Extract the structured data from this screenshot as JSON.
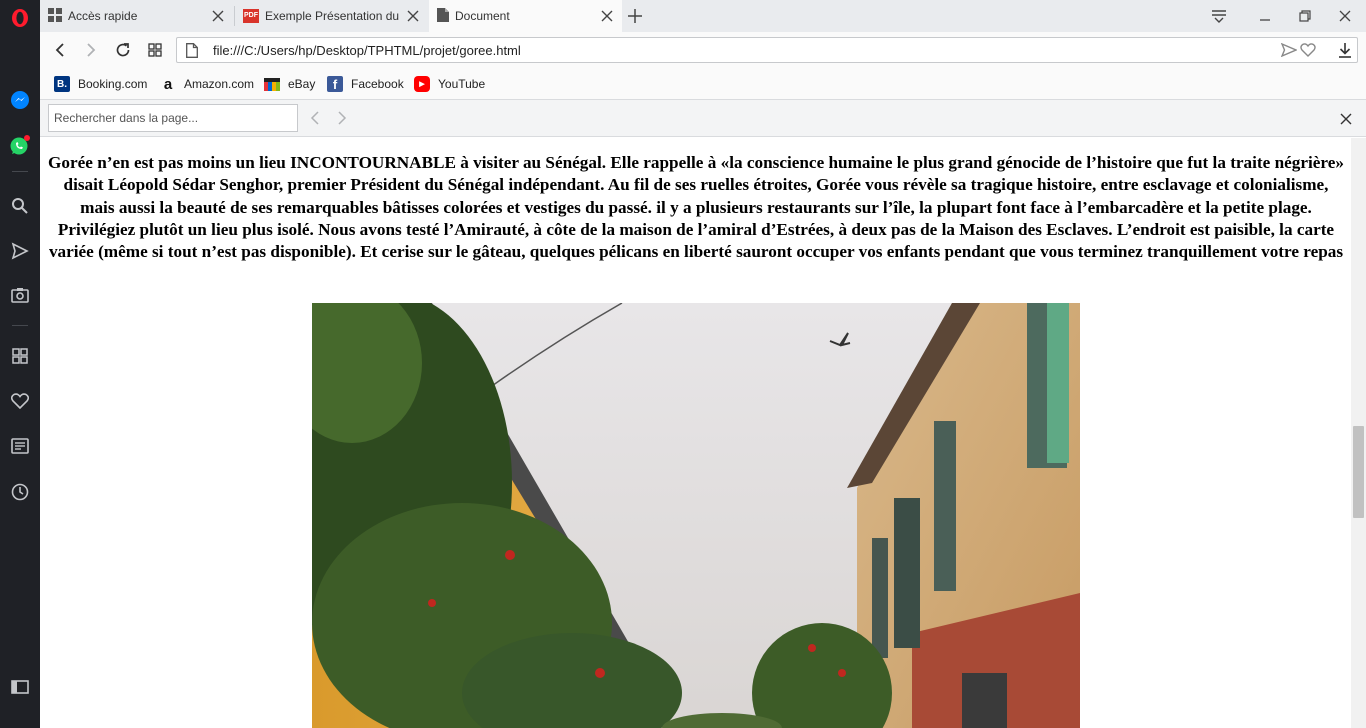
{
  "tabs": [
    {
      "label": "Accès rapide",
      "icon": "grid-icon"
    },
    {
      "label": "Exemple Présentation du p",
      "icon": "pdf-icon",
      "badge": "PDF"
    },
    {
      "label": "Document",
      "icon": "document-icon"
    }
  ],
  "address": {
    "url": "file:///C:/Users/hp/Desktop/TPHTML/projet/goree.html"
  },
  "bookmarks": [
    {
      "label": "Booking.com",
      "icon_text": "B.",
      "color": "#003580"
    },
    {
      "label": "Amazon.com",
      "icon_text": "a",
      "color": "#111111"
    },
    {
      "label": "eBay",
      "icon_text": "",
      "color": "#e53238"
    },
    {
      "label": "Facebook",
      "icon_text": "f",
      "color": "#3b5998"
    },
    {
      "label": "YouTube",
      "icon_text": "▶",
      "color": "#ff0000"
    }
  ],
  "find": {
    "placeholder": "Rechercher dans la page..."
  },
  "content": {
    "paragraph": "Gorée n’en est pas moins un lieu INCONTOURNABLE à visiter au Sénégal. Elle rappelle à «la conscience humaine le plus grand génocide de l’histoire que fut la traite négrière» disait Léopold Sédar Senghor, premier Président du Sénégal indépendant. Au fil de ses ruelles étroites, Gorée vous révèle sa tragique histoire, entre esclavage et colonialisme, mais aussi la beauté de ses remarquables bâtisses colorées et vestiges du passé. il y a plusieurs restaurants sur l’île, la plupart font face à l’embarcadère et la petite plage. Privilégiez plutôt un lieu plus isolé. Nous avons testé l’Amirauté, à côte de la maison de l’amiral d’Estrées, à deux pas de la Maison des Esclaves. L’endroit est paisible, la carte variée (même si tout n’est pas disponible). Et cerise sur le gâteau, quelques pélicans en liberté sauront occuper vos enfants pendant que vous terminez tranquillement votre repas"
  },
  "colors": {
    "sidebar": "#1f2126",
    "opera_red": "#ff1b2d",
    "messenger": "#0084ff",
    "whatsapp": "#25d366"
  }
}
